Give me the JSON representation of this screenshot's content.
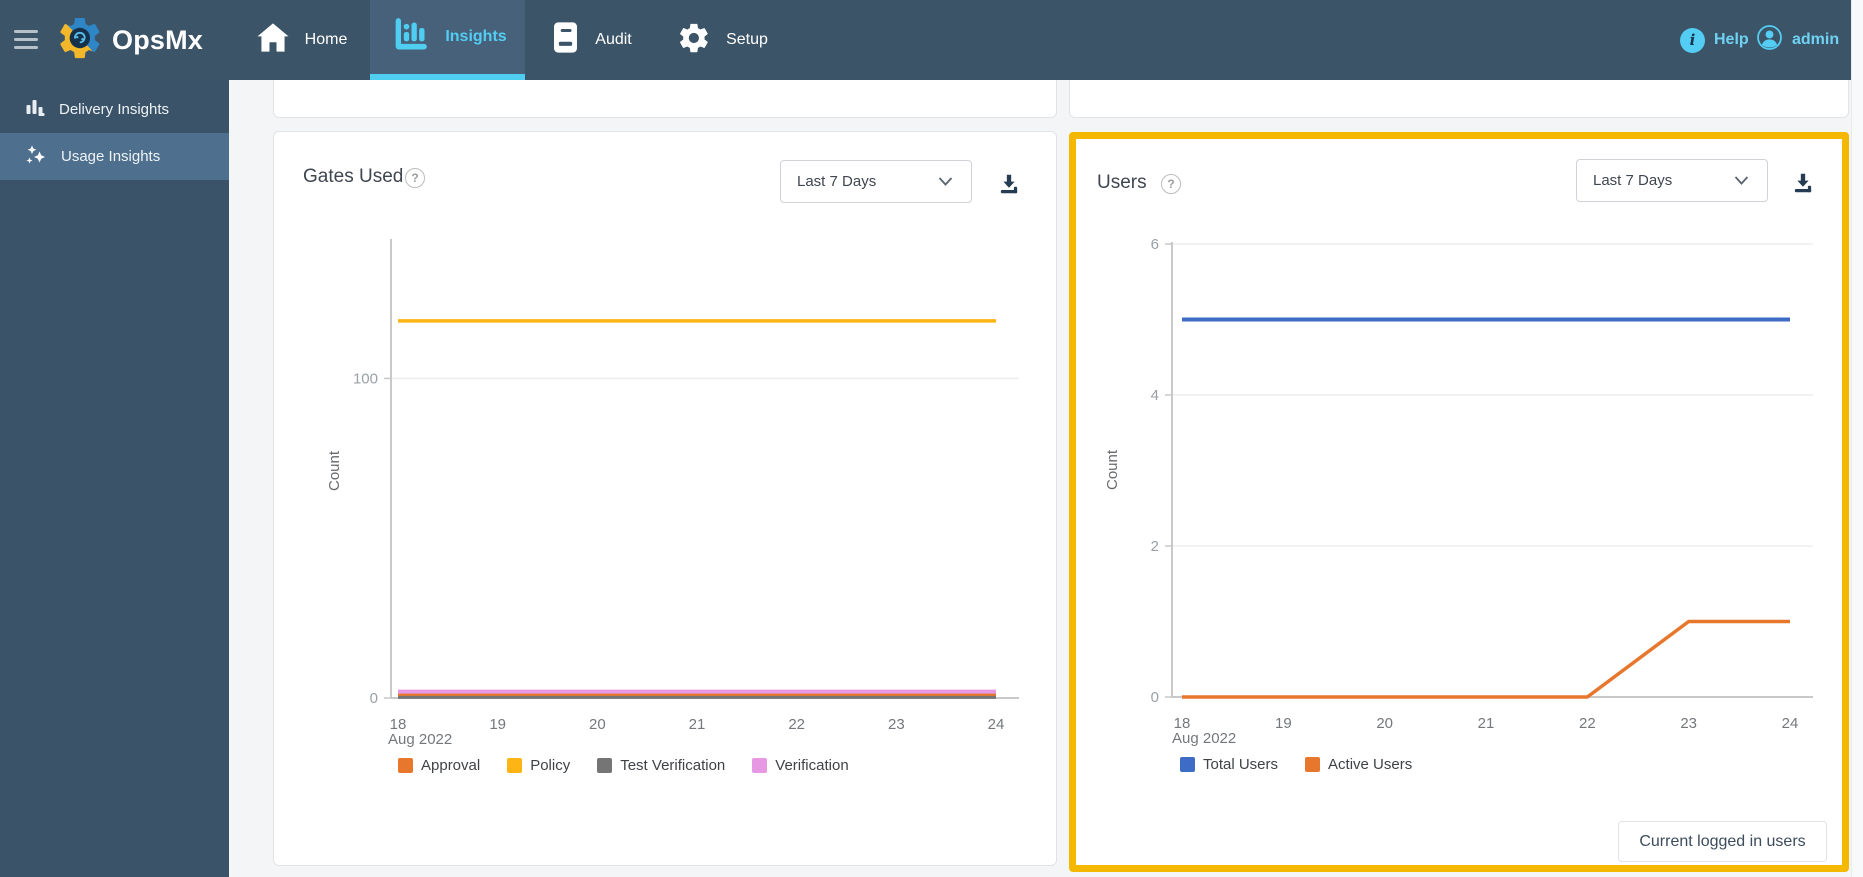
{
  "nav": {
    "brand": "OpsMx",
    "items": [
      {
        "label": "Home",
        "active": false
      },
      {
        "label": "Insights",
        "active": true
      },
      {
        "label": "Audit",
        "active": false
      },
      {
        "label": "Setup",
        "active": false
      }
    ],
    "help_label": "Help",
    "user_label": "admin"
  },
  "sidebar": {
    "items": [
      {
        "label": "Delivery Insights",
        "active": false
      },
      {
        "label": "Usage Insights",
        "active": true
      }
    ]
  },
  "panels": {
    "gates": {
      "title": "Gates Used",
      "range_value": "Last 7 Days"
    },
    "users": {
      "title": "Users",
      "range_value": "Last 7 Days",
      "footer_button_label": "Current logged in users"
    }
  },
  "colors": {
    "nav_bg": "#3c5467",
    "nav_active_bg": "#47617a",
    "accent_cyan": "#53cdf3",
    "sidebar_bg": "#3b5368",
    "sidebar_active_bg": "#4e6f8d",
    "content_bg": "#f4f5f6",
    "highlight_border": "#f5b800",
    "series_blue": "#3e6bc5",
    "series_orange": "#e8772e",
    "series_yellow": "#fdb516",
    "series_gray": "#757575",
    "series_pink": "#e698e2"
  },
  "chart_data": [
    {
      "type": "line",
      "title": "Gates Used",
      "xlabel": "",
      "ylabel": "Count",
      "x": [
        18,
        19,
        20,
        21,
        22,
        23,
        24
      ],
      "x_axis_month": "Aug 2022",
      "ylim": [
        0,
        143
      ],
      "y_ticks": [
        0,
        100
      ],
      "grid": true,
      "legend_position": "bottom",
      "series": [
        {
          "name": "Approval",
          "color": "#e8772e",
          "width": 4,
          "values": [
            1,
            1,
            1,
            1,
            1,
            1,
            1
          ]
        },
        {
          "name": "Policy",
          "color": "#fdb516",
          "width": 3.5,
          "values": [
            118,
            118,
            118,
            118,
            118,
            118,
            118
          ]
        },
        {
          "name": "Test Verification",
          "color": "#757575",
          "width": 3,
          "values": [
            0.2,
            0.2,
            0.2,
            0.2,
            0.2,
            0.2,
            0.2
          ]
        },
        {
          "name": "Verification",
          "color": "#e698e2",
          "width": 4,
          "values": [
            2,
            2,
            2,
            2,
            2,
            2,
            2
          ]
        }
      ]
    },
    {
      "type": "line",
      "title": "Users",
      "xlabel": "",
      "ylabel": "Count",
      "x": [
        18,
        19,
        20,
        21,
        22,
        23,
        24
      ],
      "x_axis_month": "Aug 2022",
      "ylim": [
        0,
        6
      ],
      "y_ticks": [
        0,
        2,
        4,
        6
      ],
      "grid": true,
      "legend_position": "bottom",
      "series": [
        {
          "name": "Total Users",
          "color": "#3e6bc5",
          "width": 4,
          "values": [
            5,
            5,
            5,
            5,
            5,
            5,
            5
          ]
        },
        {
          "name": "Active Users",
          "color": "#e8772e",
          "width": 3.5,
          "values": [
            0,
            0,
            0,
            0,
            0,
            1,
            1
          ]
        }
      ]
    }
  ]
}
